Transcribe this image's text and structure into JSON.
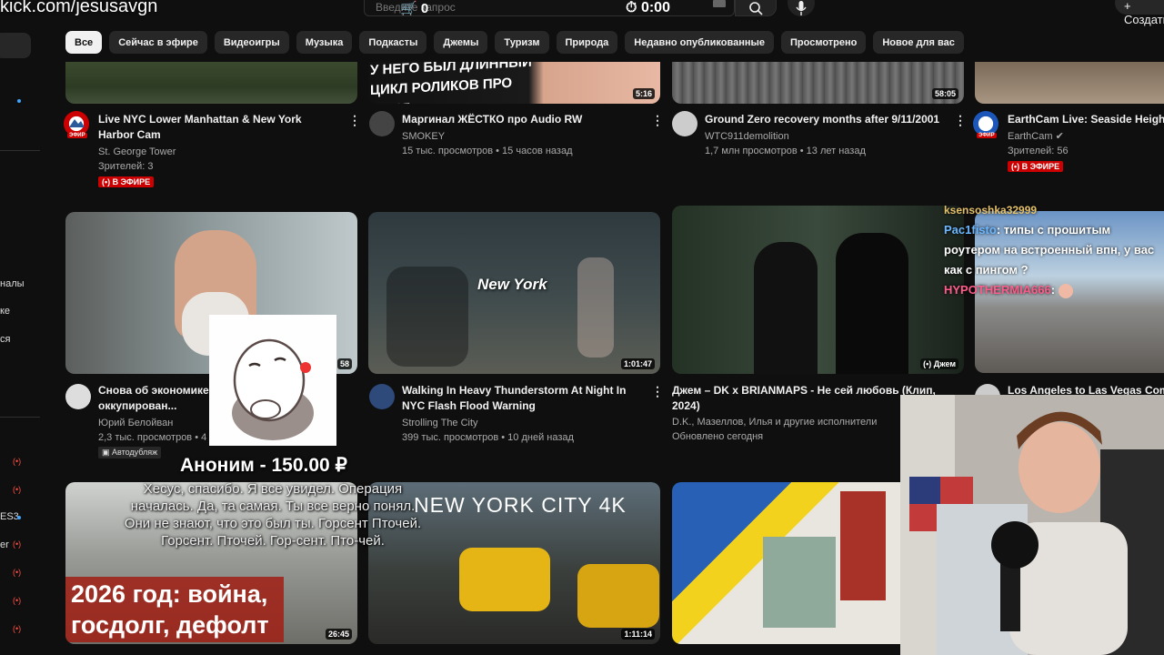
{
  "overlay": {
    "stream_url": "kick.com/jesusavgn",
    "cart_count": "0",
    "timer": "0:00"
  },
  "search": {
    "placeholder": "Введите запрос"
  },
  "header": {
    "create_label": "Создать"
  },
  "sidebar": {
    "items": [
      "налы",
      "ке",
      "ся",
      "ES3",
      "er"
    ]
  },
  "chips": [
    "Все",
    "Сейчас в эфире",
    "Видеоигры",
    "Музыка",
    "Подкасты",
    "Джемы",
    "Туризм",
    "Природа",
    "Недавно опубликованные",
    "Просмотрено",
    "Новое для вас"
  ],
  "videos": [
    {
      "title": "Live NYC Lower Manhattan & New York Harbor Cam",
      "channel": "St. George Tower",
      "meta": "Зрителей: 3",
      "badge": "В ЭФИРЕ",
      "avatar_label": "ЭФИР"
    },
    {
      "title": "Маргинал ЖЁСТКО про Audio RW",
      "channel": "SMOKEY",
      "meta": "15 тыс. просмотров • 15 часов назад",
      "duration": "5:16",
      "thumb_text": "У НЕГО БЫЛ ДЛИННЫЙ ЦИКЛ РОЛИКОВ ПРО МЕНЯ"
    },
    {
      "title": "Ground Zero recovery months after 9/11/2001",
      "channel": "WTC911demolition",
      "meta": "1,7 млн просмотров • 13 лет назад",
      "duration": "58:05"
    },
    {
      "title": "EarthCam Live: Seaside Heights",
      "channel": "EarthCam",
      "meta": "Зрителей: 56",
      "badge": "В ЭФИРЕ",
      "avatar_label": "ЭФИР"
    },
    {
      "title": "Снова об экономике ... грабила оккупирован...",
      "channel": "Юрий Белойван",
      "meta": "2,3 тыс. просмотров • 4",
      "duration": "58",
      "badge": "Автодубляж"
    },
    {
      "title": "Walking In Heavy Thunderstorm At Night In NYC Flash Flood Warning",
      "channel": "Strolling The City",
      "meta": "399 тыс. просмотров • 10 дней назад",
      "duration": "1:01:47",
      "thumb_text": "New York"
    },
    {
      "title": "Джем – DK x BRIANMAPS - Не сей любовь (Клип, 2024)",
      "channel": "D.K., Мазеллов, Илья и другие исполнители",
      "meta": "Обновлено сегодня",
      "jam_label": "Джем"
    },
    {
      "title": "Los Angeles to Las Vegas Comp",
      "channel": "",
      "meta": ""
    },
    {
      "title": "",
      "channel": "",
      "meta": "",
      "duration": "26:45",
      "thumb_text": "2026 год: война, госдолг, дефолт"
    },
    {
      "title": "",
      "channel": "",
      "meta": "",
      "duration": "1:11:14",
      "thumb_text": "NEW YORK CITY 4K"
    },
    {
      "title": "",
      "channel": "",
      "meta": ""
    }
  ],
  "donation": {
    "name": "Аноним - 150.00 ₽",
    "message": "Хесус, спасибо. Я все увидел. Операция началась. Да, та самая. Ты все верно понял. Они не знают, что это был ты. Горсент Пточей. Горсент. Пточей. Гор-сент. Пто-чей."
  },
  "chat": {
    "top_user": "ksensoshka32999",
    "messages": [
      {
        "user": "Pac1fisto",
        "text": ": типы с прошитым роутером на встроенный впн, у вас как с пингом ?",
        "color": "#6ab7ff"
      },
      {
        "user": "HYPOTHERMIA666",
        "text": ":",
        "color": "#ff5c8a"
      }
    ]
  },
  "colors": {
    "bg": "#0f0f0f",
    "chip": "#272727",
    "live": "#cc0000",
    "accent": "#3ea6ff"
  }
}
